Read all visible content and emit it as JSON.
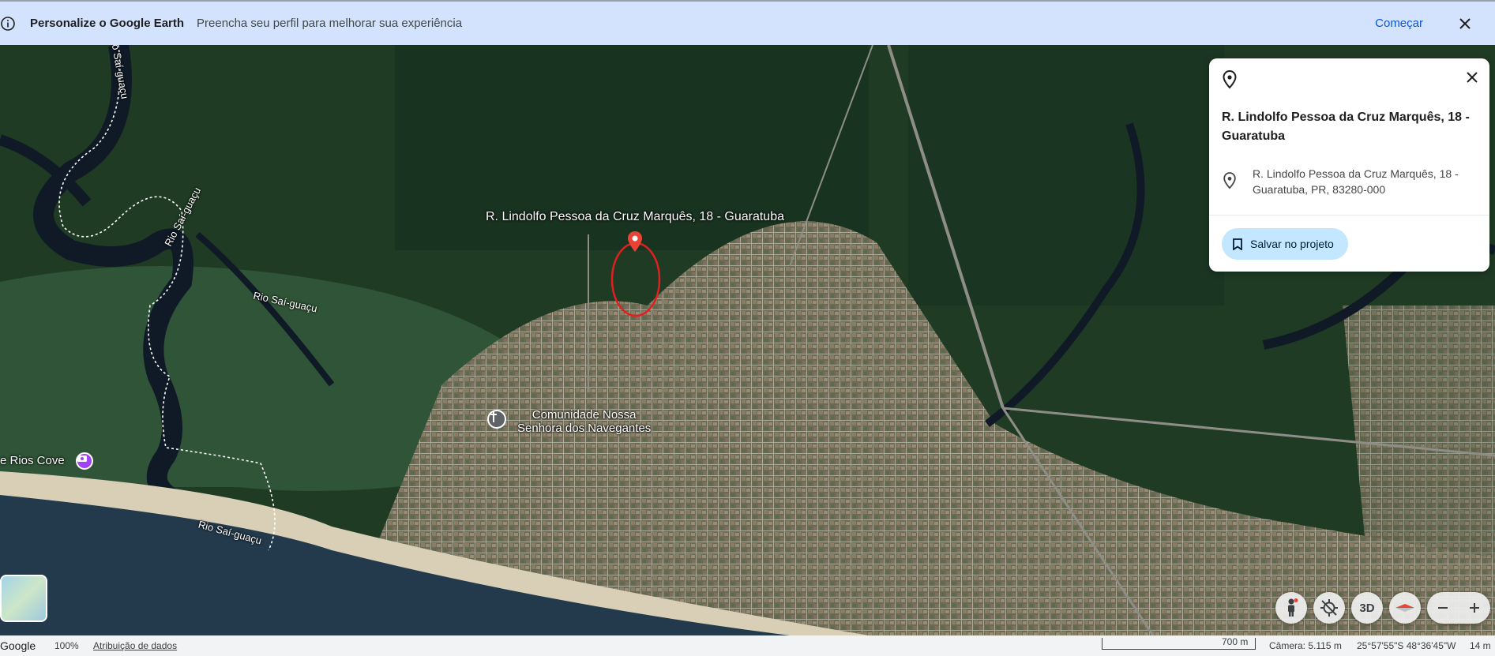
{
  "banner": {
    "title": "Personalize o Google Earth",
    "subtitle": "Preencha seu perfil para melhorar sua experiência",
    "action": "Começar"
  },
  "map": {
    "labels": {
      "pin_address": "R. Lindolfo Pessoa da Cruz Marquês, 18 - Guaratuba",
      "river_1": "Rio Saí-guaçu",
      "river_2": "Rio Saí-guaçu",
      "river_3": "Rio Saí-guaçu",
      "river_4": "Rio Saí-guaçu",
      "church_line1": "Comunidade Nossa",
      "church_line2": "Senhora dos Navegantes",
      "cove": "e Rios Cove"
    }
  },
  "card": {
    "title": "R. Lindolfo Pessoa da Cruz Marquês, 18 - Guaratuba",
    "address": "R. Lindolfo Pessoa da Cruz Marquês, 18 - Guaratuba, PR, 83280-000",
    "save_label": "Salvar no projeto"
  },
  "controls": {
    "three_d_label": "3D"
  },
  "footer": {
    "brand": "Google",
    "zoom": "100%",
    "attribution": "Atribuição de dados",
    "scale_label": "700 m",
    "camera": "Câmera: 5.115 m",
    "coordinates": "25°57'55\"S 48°36'45\"W",
    "elevation": "14 m"
  },
  "colors": {
    "banner_bg": "#d3e3fd",
    "accent": "#0b57d0",
    "save_button_bg": "#c2e7ff",
    "pin_red": "#ea4335"
  }
}
